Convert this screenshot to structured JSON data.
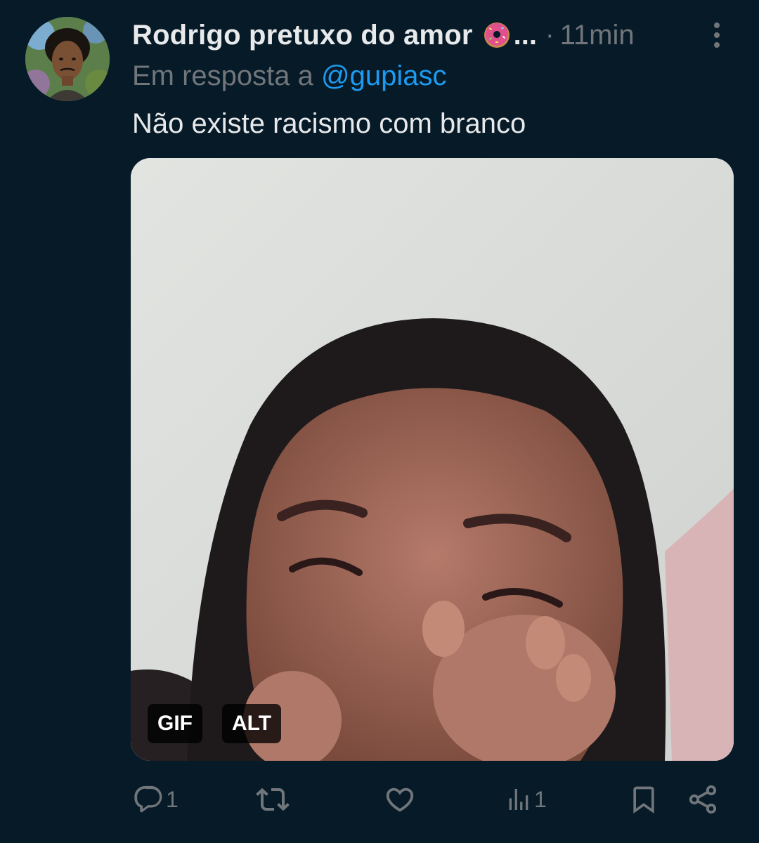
{
  "tweet": {
    "author_name": "Rodrigo pretuxo do amor",
    "name_emoji_icon": "donut-icon",
    "name_truncation": "...",
    "separator": "·",
    "time": "11min",
    "reply_prefix": "Em resposta a",
    "reply_handle": "@gupiasc",
    "text": "Não existe racismo com branco",
    "media": {
      "type_badge": "GIF",
      "alt_badge": "ALT"
    },
    "actions": {
      "reply_count": "1",
      "retweet_count": "",
      "like_count": "",
      "views_count": "1"
    }
  },
  "colors": {
    "background": "#061a28",
    "primary_text": "#e7e9ea",
    "secondary_text": "#71767b",
    "link": "#1d9bf0"
  }
}
